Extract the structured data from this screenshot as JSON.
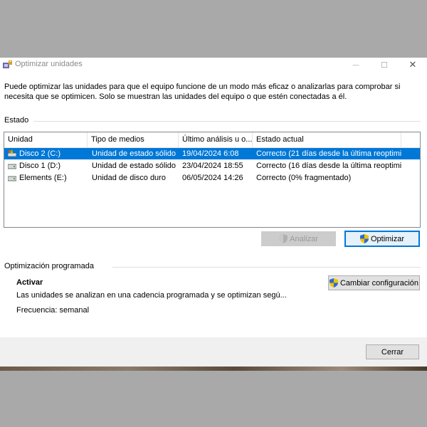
{
  "window": {
    "title": "Optimizar unidades",
    "description_line1": "Puede optimizar las unidades para que el equipo funcione de un modo más eficaz o analizarlas para comprobar si",
    "description_line2": "necesita que se optimicen. Solo se muestran las unidades del equipo o que estén conectadas a él.",
    "controls": {
      "minimize": "—",
      "maximize": "☐",
      "close": "✕"
    }
  },
  "status": {
    "label": "Estado",
    "columns": [
      "Unidad",
      "Tipo de medios",
      "Último análisis u o...",
      "Estado actual"
    ],
    "rows": [
      {
        "unit": "Disco 2 (C:)",
        "media": "Unidad de estado sólido",
        "last": "19/04/2024 6:08",
        "state": "Correcto (21 días desde la última reoptimi...",
        "selected": true,
        "icon": "os-drive-icon"
      },
      {
        "unit": "Disco 1 (D:)",
        "media": "Unidad de estado sólido",
        "last": "23/04/2024 18:55",
        "state": "Correcto (16 días desde la última reoptimi...",
        "selected": false,
        "icon": "drive-icon"
      },
      {
        "unit": "Elements (E:)",
        "media": "Unidad de disco duro",
        "last": "06/05/2024 14:26",
        "state": "Correcto (0% fragmentado)",
        "selected": false,
        "icon": "drive-icon"
      }
    ]
  },
  "buttons": {
    "analyze": "Analizar",
    "optimize": "Optimizar",
    "change_config": "Cambiar configuración",
    "close": "Cerrar"
  },
  "scheduled": {
    "label": "Optimización programada",
    "state": "Activar",
    "info": "Las unidades se analizan en una cadencia programada y se optimizan segú...",
    "frequency": "Frecuencia: semanal"
  },
  "colors": {
    "selection": "#0078d7",
    "window_bg": "#ffffff",
    "footer_bg": "#f0f0f0"
  }
}
